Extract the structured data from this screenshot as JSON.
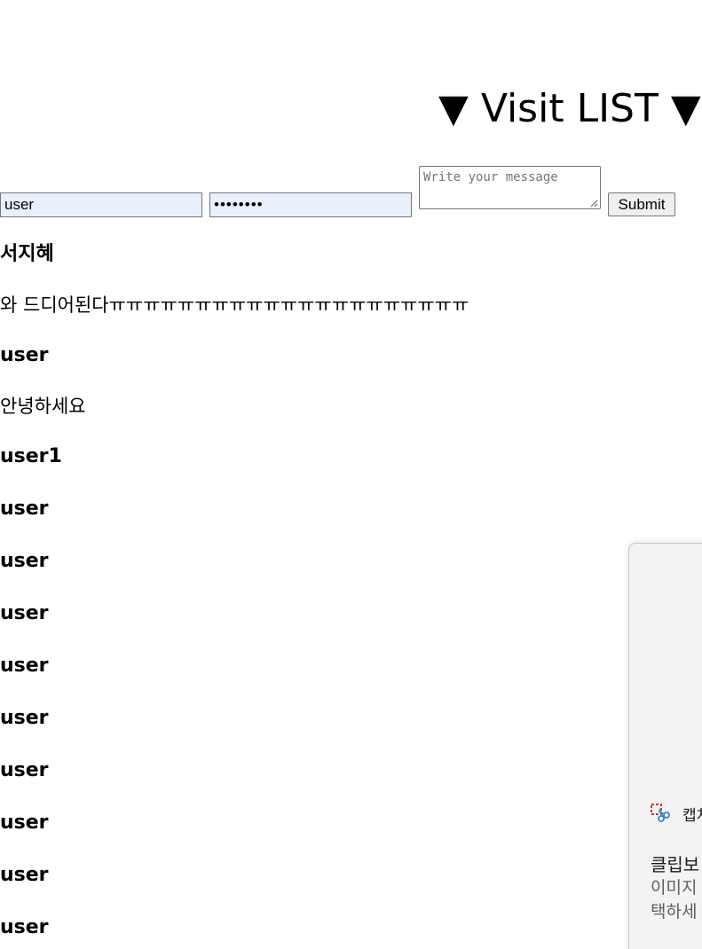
{
  "header": {
    "title": "▼ Visit LIST ▼"
  },
  "form": {
    "username_value": "user",
    "password_value": "••••••••",
    "message_placeholder": "Write your message",
    "submit_label": "Submit"
  },
  "entries": [
    {
      "name": "서지혜",
      "message": "와 드디어된다ㅠㅠㅠㅠㅠㅠㅠㅠㅠㅠㅠㅠㅠㅠㅠㅠㅠㅠㅠㅠㅠ"
    },
    {
      "name": "user",
      "message": "안녕하세요"
    },
    {
      "name": "user1",
      "message": ""
    },
    {
      "name": "user",
      "message": ""
    },
    {
      "name": "user",
      "message": ""
    },
    {
      "name": "user",
      "message": ""
    },
    {
      "name": "user",
      "message": ""
    },
    {
      "name": "user",
      "message": ""
    },
    {
      "name": "user",
      "message": ""
    },
    {
      "name": "user",
      "message": ""
    },
    {
      "name": "user",
      "message": ""
    },
    {
      "name": "user",
      "message": ""
    }
  ],
  "notification": {
    "app_name": "캡처",
    "title": "클립보",
    "body_line1": "이미지",
    "body_line2": "택하세",
    "icon": "snipping-tool-icon"
  }
}
